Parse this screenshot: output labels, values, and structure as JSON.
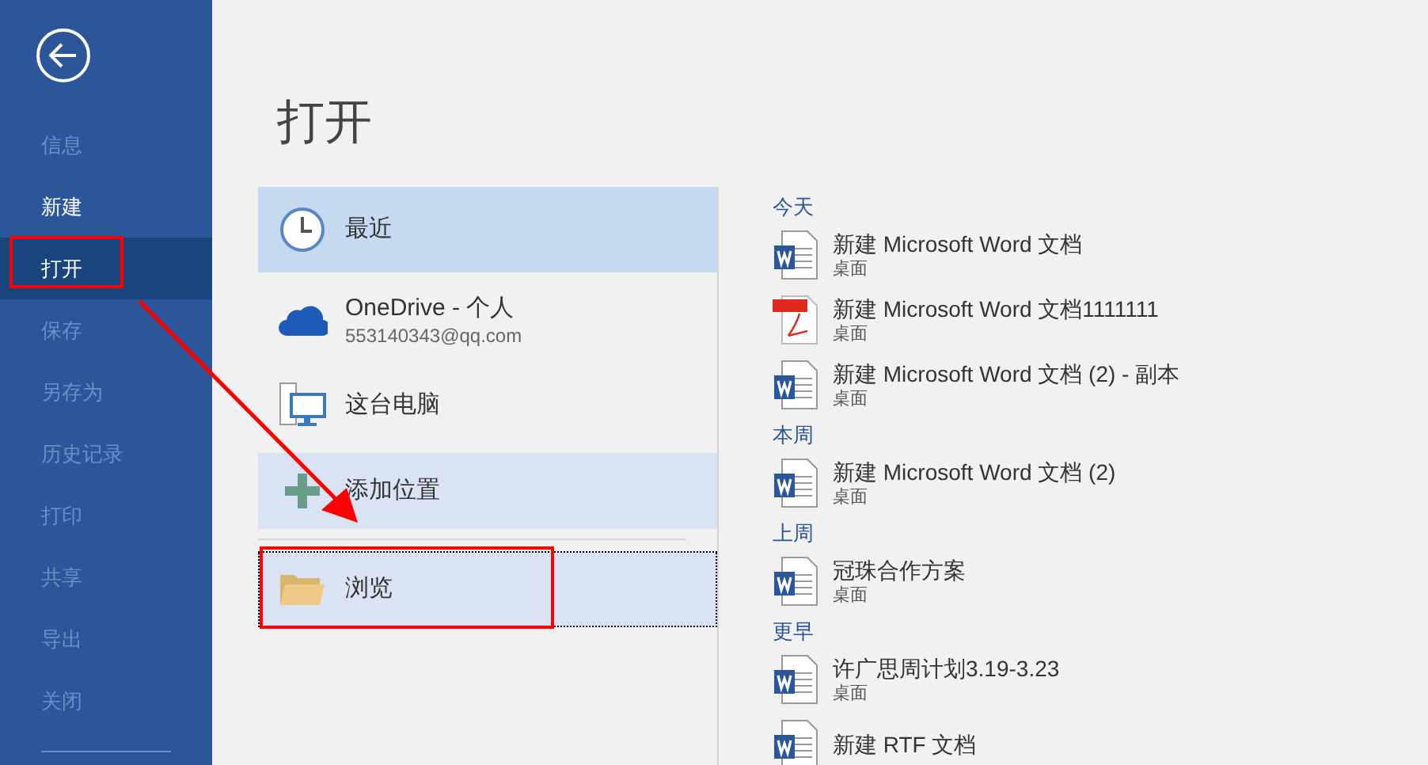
{
  "sidebar": {
    "items": [
      {
        "label": "信息",
        "selected": false,
        "disabled": true
      },
      {
        "label": "新建",
        "selected": false,
        "disabled": false
      },
      {
        "label": "打开",
        "selected": true,
        "disabled": false
      },
      {
        "label": "保存",
        "selected": false,
        "disabled": true
      },
      {
        "label": "另存为",
        "selected": false,
        "disabled": true
      },
      {
        "label": "历史记录",
        "selected": false,
        "disabled": true
      },
      {
        "label": "打印",
        "selected": false,
        "disabled": true
      },
      {
        "label": "共享",
        "selected": false,
        "disabled": true
      },
      {
        "label": "导出",
        "selected": false,
        "disabled": true
      },
      {
        "label": "关闭",
        "selected": false,
        "disabled": true
      }
    ]
  },
  "title": "打开",
  "places": [
    {
      "kind": "clock",
      "label": "最近",
      "selected": true,
      "highlighted": false,
      "focused": false
    },
    {
      "kind": "cloud",
      "label": "OneDrive - 个人",
      "sublabel": "553140343@qq.com",
      "selected": false,
      "highlighted": false,
      "focused": false
    },
    {
      "kind": "computer",
      "label": "这台电脑",
      "selected": false,
      "highlighted": false,
      "focused": false
    },
    {
      "kind": "add",
      "label": "添加位置",
      "selected": false,
      "highlighted": true,
      "focused": false
    },
    {
      "kind": "folder",
      "label": "浏览",
      "selected": false,
      "highlighted": true,
      "focused": true
    }
  ],
  "recent": [
    {
      "heading": "今天",
      "files": [
        {
          "kind": "word",
          "name": "新建 Microsoft Word 文档",
          "location": "桌面"
        },
        {
          "kind": "pdf",
          "name": "新建 Microsoft Word 文档1111111",
          "location": "桌面"
        },
        {
          "kind": "word",
          "name": "新建 Microsoft Word 文档 (2) - 副本",
          "location": "桌面"
        }
      ]
    },
    {
      "heading": "本周",
      "files": [
        {
          "kind": "word",
          "name": "新建 Microsoft Word 文档 (2)",
          "location": "桌面"
        }
      ]
    },
    {
      "heading": "上周",
      "files": [
        {
          "kind": "word",
          "name": "冠珠合作方案",
          "location": "桌面"
        }
      ]
    },
    {
      "heading": "更早",
      "files": [
        {
          "kind": "word",
          "name": "许广思周计划3.19-3.23",
          "location": "桌面"
        },
        {
          "kind": "word",
          "name": "新建 RTF 文档"
        }
      ]
    }
  ]
}
